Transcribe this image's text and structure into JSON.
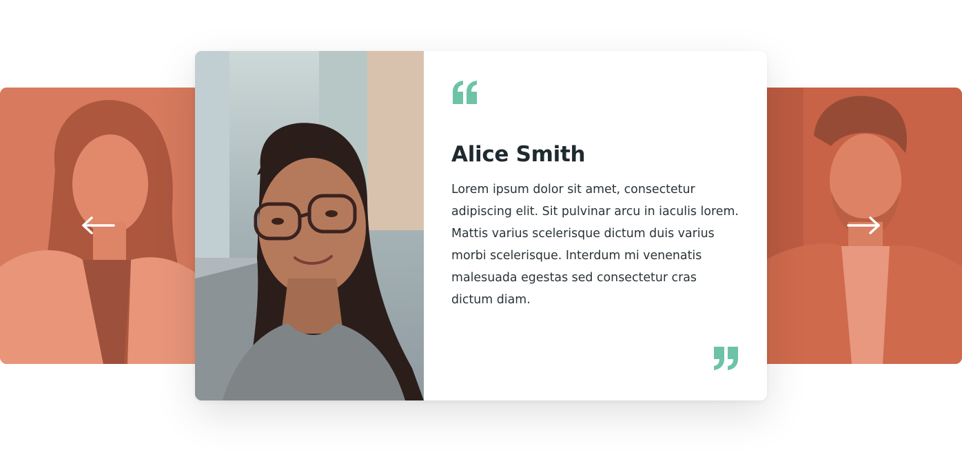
{
  "testimonial": {
    "name": "Alice Smith",
    "quote": "Lorem ipsum dolor sit amet, consectetur adipiscing elit. Sit pulvinar arcu in iaculis lorem. Mattis varius scelerisque dictum duis varius morbi scelerisque. Interdum mi venenatis malesuada egestas sed consectetur cras dictum diam."
  },
  "carousel": {
    "prev_icon": "arrow-left-icon",
    "next_icon": "arrow-right-icon"
  },
  "colors": {
    "accent": "#6dc3a7",
    "side_overlay": "#e27050",
    "text_dark": "#1f2a30"
  }
}
